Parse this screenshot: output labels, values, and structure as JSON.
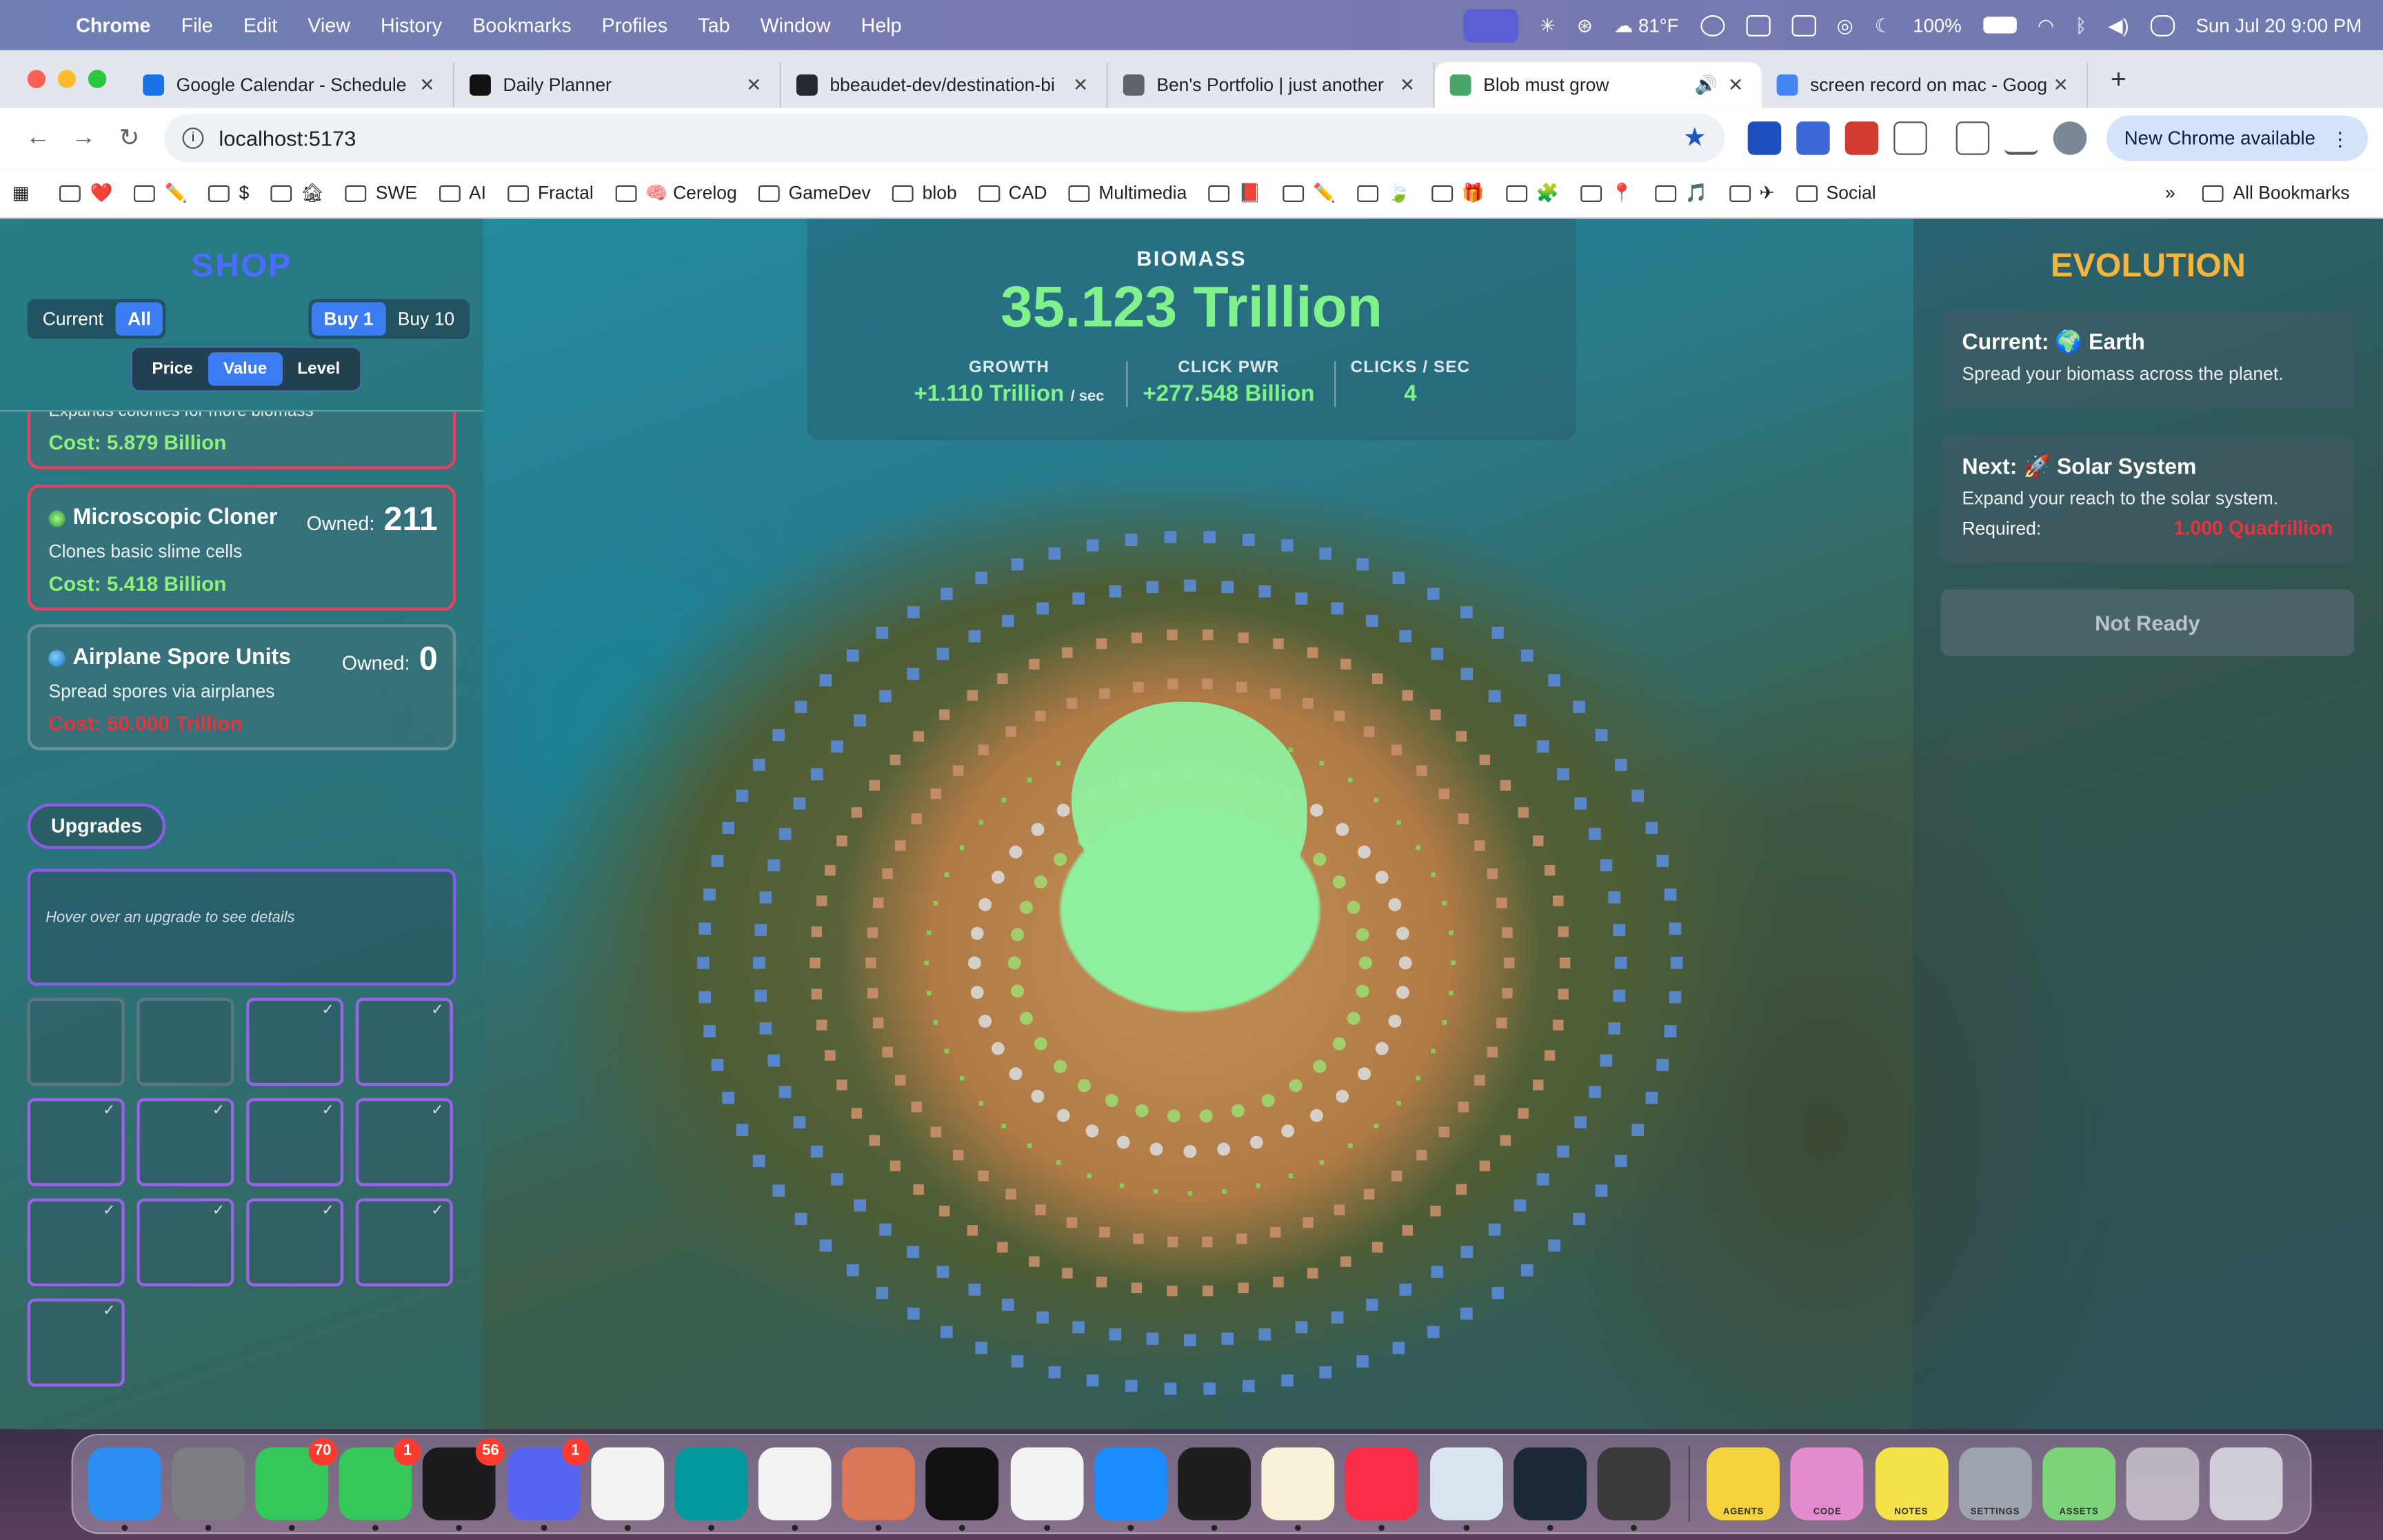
{
  "menubar": {
    "app": "Chrome",
    "items": [
      "File",
      "Edit",
      "View",
      "History",
      "Bookmarks",
      "Profiles",
      "Tab",
      "Window",
      "Help"
    ],
    "weather": "81°F",
    "battery": "100%",
    "datetime": "Sun Jul 20  9:00 PM"
  },
  "tabs": [
    {
      "title": "Google Calendar - Schedule",
      "color": "#1a73e8"
    },
    {
      "title": "Daily Planner",
      "color": "#111111"
    },
    {
      "title": "bbeaudet-dev/destination-bi",
      "color": "#24292f"
    },
    {
      "title": "Ben's Portfolio | just another",
      "color": "#5f6368"
    },
    {
      "title": "Blob must grow",
      "color": "#4aa56b"
    },
    {
      "title": "screen record on mac - Goog",
      "color": "#4285f4"
    }
  ],
  "address": {
    "url": "localhost:5173",
    "new_chrome": "New Chrome available"
  },
  "bookmarks": {
    "items": [
      "❤️",
      "✏️",
      "$",
      "🏚",
      "SWE",
      "AI",
      "Fractal",
      "🧠 Cerelog",
      "GameDev",
      "blob",
      "CAD",
      "Multimedia",
      "📕",
      "✏️",
      "🍃",
      "🎁",
      "🧩",
      "📍",
      "🎵",
      "✈",
      "Social"
    ],
    "all": "All Bookmarks"
  },
  "shop": {
    "title": "SHOP",
    "filter": [
      "Current",
      "All"
    ],
    "buy": [
      "Buy 1",
      "Buy 10"
    ],
    "sort": [
      "Price",
      "Value",
      "Level"
    ],
    "partial_cost": "Cost: 5.879 Billion",
    "partial_desc": "Expands colonies for more biomass",
    "cards": [
      {
        "name": "Microscopic Cloner",
        "owned_label": "Owned:",
        "owned": "211",
        "desc": "Clones basic slime cells",
        "cost": "Cost: 5.418 Billion"
      },
      {
        "name": "Airplane Spore Units",
        "owned_label": "Owned:",
        "owned": "0",
        "desc": "Spread spores via airplanes",
        "cost": "Cost: 50.000 Trillion"
      }
    ],
    "upgrades_label": "Upgrades",
    "upgrade_hint": "Hover over an upgrade to see details",
    "upgrade_cells": [
      false,
      false,
      true,
      true,
      true,
      true,
      true,
      true,
      true,
      true,
      true,
      true,
      true
    ]
  },
  "hud": {
    "biomass_label": "BIOMASS",
    "biomass": "35.123 Trillion",
    "growth_label": "GROWTH",
    "growth": "+1.110 Trillion",
    "growth_unit": "/ sec",
    "click_label": "CLICK PWR",
    "click": "+277.548 Billion",
    "cps_label": "CLICKS / SEC",
    "cps": "4"
  },
  "evolution": {
    "title": "EVOLUTION",
    "current_title": "Current: 🌍 Earth",
    "current_desc": "Spread your biomass across the planet.",
    "next_title": "Next: 🚀 Solar System",
    "next_desc": "Expand your reach to the solar system.",
    "required_label": "Required:",
    "required_value": "1.000 Quadrillion",
    "button": "Not Ready"
  },
  "dock": {
    "apps": [
      {
        "name": "Finder",
        "color": "#2c8ef0"
      },
      {
        "name": "System Settings",
        "color": "#7d7d82"
      },
      {
        "name": "Messages",
        "color": "#34c759",
        "badge": "70"
      },
      {
        "name": "FaceTime",
        "color": "#34c759",
        "badge": "1"
      },
      {
        "name": "Layers",
        "color": "#1c1c1e",
        "badge": "56"
      },
      {
        "name": "Discord",
        "color": "#5865f2",
        "badge": "1"
      },
      {
        "name": "VS Code",
        "color": "#f3f3f3"
      },
      {
        "name": "Arduino",
        "color": "#00979d"
      },
      {
        "name": "ChatGPT",
        "color": "#f2f2f2"
      },
      {
        "name": "Claude",
        "color": "#d97757"
      },
      {
        "name": "Cursor",
        "color": "#111111"
      },
      {
        "name": "Chrome",
        "color": "#f2f2f2"
      },
      {
        "name": "Safari",
        "color": "#1a8cff"
      },
      {
        "name": "Terminal",
        "color": "#1e1e1e"
      },
      {
        "name": "Notes",
        "color": "#f7f2d8"
      },
      {
        "name": "Music",
        "color": "#fa2d48"
      },
      {
        "name": "Preview",
        "color": "#d9e6f2"
      },
      {
        "name": "Steam",
        "color": "#1b2838"
      },
      {
        "name": "QuickTime",
        "color": "#3a3a3c"
      }
    ],
    "folders": [
      {
        "name": "AGENTS",
        "color": "#f5d33f"
      },
      {
        "name": "CODE",
        "color": "#e58bd0"
      },
      {
        "name": "NOTES",
        "color": "#f5e24a"
      },
      {
        "name": "SETTINGS",
        "color": "#9da4ad"
      },
      {
        "name": "ASSETS",
        "color": "#7ed47a"
      }
    ]
  }
}
